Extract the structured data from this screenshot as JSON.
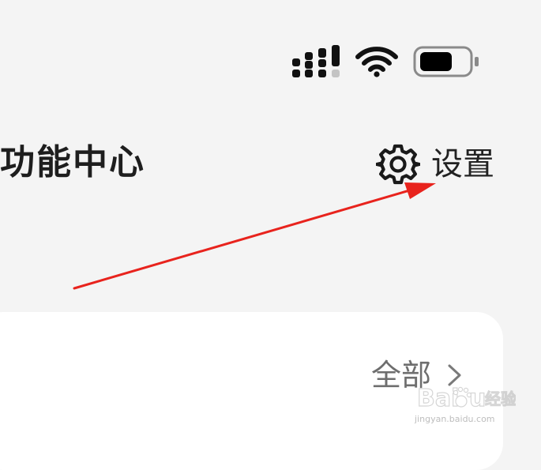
{
  "status_bar": {
    "icons": [
      "signal-icon",
      "wifi-icon",
      "battery-icon"
    ]
  },
  "header": {
    "title": "功能中心",
    "settings": {
      "icon": "gear-icon",
      "label": "设置"
    }
  },
  "card": {
    "link_label": "全部",
    "link_icon": "chevron-right-icon"
  },
  "annotation": {
    "type": "arrow",
    "color": "#e8231d",
    "points_to": "settings-button"
  },
  "watermark": {
    "logo_text": "Baidu经验",
    "url": "jingyan.baidu.com"
  }
}
